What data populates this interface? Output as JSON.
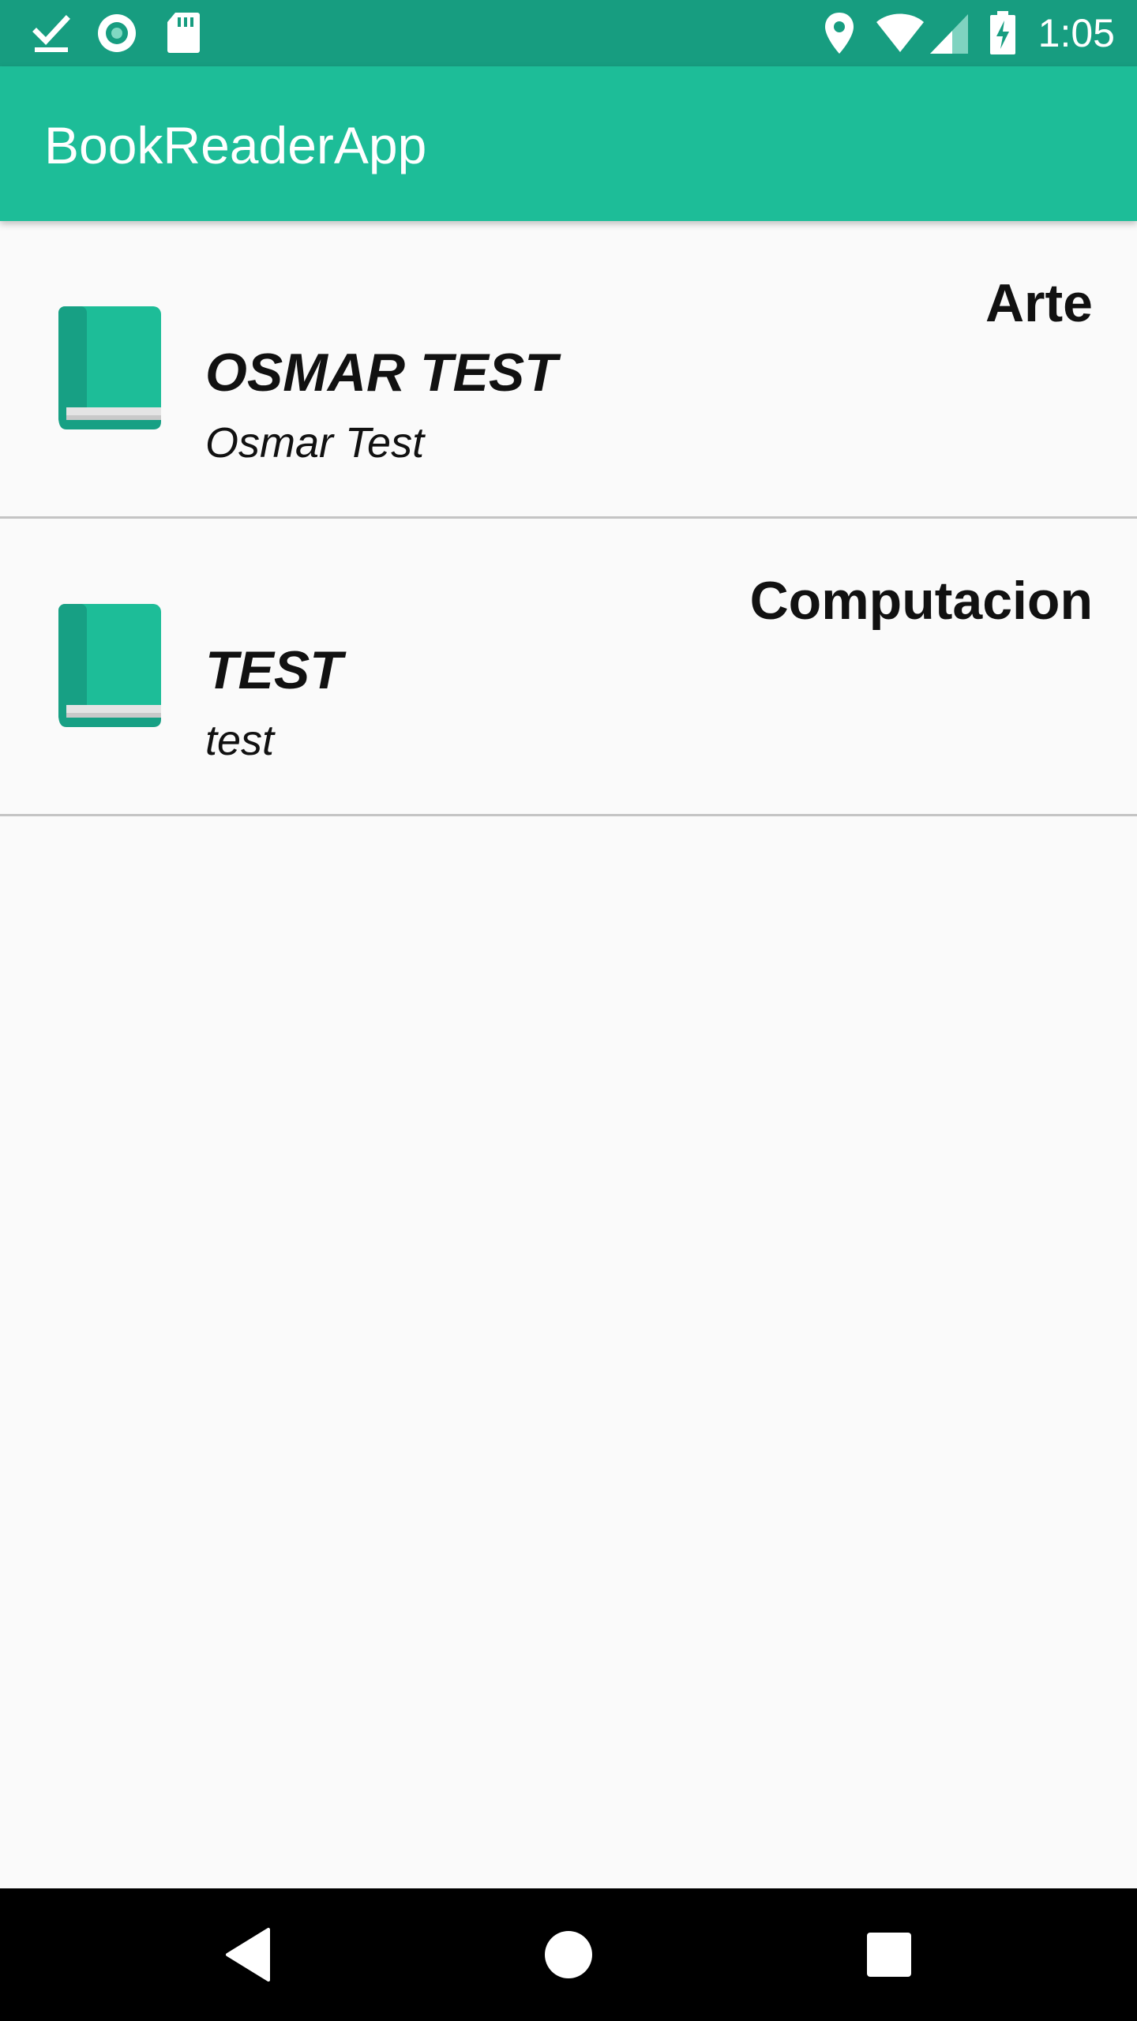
{
  "status_bar": {
    "time": "1:05",
    "icons": [
      "download-done-icon",
      "record-icon",
      "sd-card-icon",
      "location-icon",
      "wifi-icon",
      "signal-icon",
      "battery-charging-icon"
    ]
  },
  "app_bar": {
    "title": "BookReaderApp"
  },
  "books": [
    {
      "title": "OSMAR TEST",
      "author": "Osmar Test",
      "category": "Arte",
      "icon": "book-icon"
    },
    {
      "title": "TEST",
      "author": "test",
      "category": "Computacion",
      "icon": "book-icon"
    }
  ],
  "nav_bar": {
    "buttons": [
      "back-icon",
      "home-icon",
      "recents-icon"
    ]
  },
  "colors": {
    "status_bar": "#179d80",
    "app_bar": "#1dbd98",
    "background": "#fafafa",
    "divider": "#c4c4c4",
    "book_cover": "#1dbd98",
    "book_spine": "#17a084"
  }
}
